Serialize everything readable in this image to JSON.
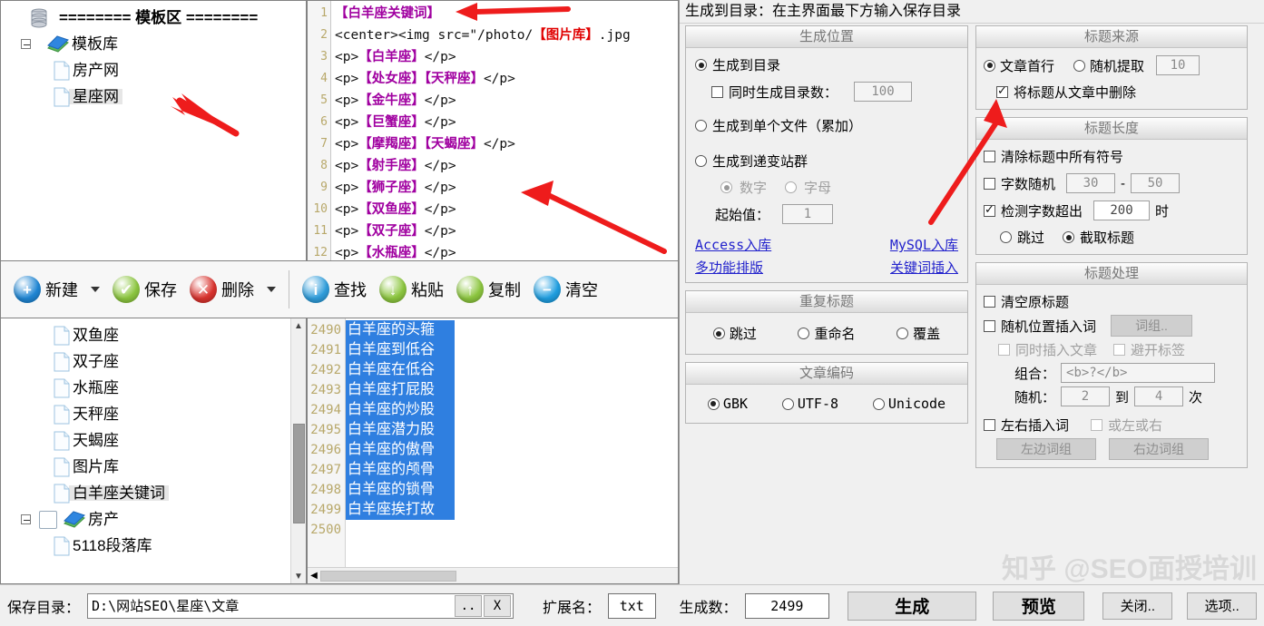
{
  "template_tree": {
    "root_label": "======== 模板区 ========",
    "root_icon": "database-icon",
    "items": [
      {
        "label": "模板库",
        "icon": "book-icon",
        "level": 1,
        "expander": true,
        "selected": false
      },
      {
        "label": "房产网",
        "icon": "doc-icon",
        "level": 2,
        "expander": false,
        "selected": false
      },
      {
        "label": "星座网",
        "icon": "doc-icon",
        "level": 2,
        "expander": false,
        "selected": true
      }
    ]
  },
  "editor": {
    "lines": [
      {
        "n": "1",
        "parts": [
          {
            "t": "【白羊座关键词】",
            "c": "kw"
          }
        ]
      },
      {
        "n": "2",
        "parts": [
          {
            "t": "<center><img src=\"/photo/",
            "c": "tag"
          },
          {
            "t": "【图片库】",
            "c": "kwred"
          },
          {
            "t": ".jpg",
            "c": "tag"
          }
        ]
      },
      {
        "n": "3",
        "parts": [
          {
            "t": "<p>",
            "c": "tag"
          },
          {
            "t": "【白羊座】",
            "c": "kw"
          },
          {
            "t": "</p>",
            "c": "tag"
          }
        ]
      },
      {
        "n": "4",
        "parts": [
          {
            "t": "<p>",
            "c": "tag"
          },
          {
            "t": "【处女座】",
            "c": "kw"
          },
          {
            "t": "【天秤座】",
            "c": "kw"
          },
          {
            "t": "</p>",
            "c": "tag"
          }
        ]
      },
      {
        "n": "5",
        "parts": [
          {
            "t": "<p>",
            "c": "tag"
          },
          {
            "t": "【金牛座】",
            "c": "kw"
          },
          {
            "t": "</p>",
            "c": "tag"
          }
        ]
      },
      {
        "n": "6",
        "parts": [
          {
            "t": "<p>",
            "c": "tag"
          },
          {
            "t": "【巨蟹座】",
            "c": "kw"
          },
          {
            "t": "</p>",
            "c": "tag"
          }
        ]
      },
      {
        "n": "7",
        "parts": [
          {
            "t": "<p>",
            "c": "tag"
          },
          {
            "t": "【摩羯座】",
            "c": "kw"
          },
          {
            "t": "【天蝎座】",
            "c": "kw"
          },
          {
            "t": "</p>",
            "c": "tag"
          }
        ]
      },
      {
        "n": "8",
        "parts": [
          {
            "t": "<p>",
            "c": "tag"
          },
          {
            "t": "【射手座】",
            "c": "kw"
          },
          {
            "t": "</p>",
            "c": "tag"
          }
        ]
      },
      {
        "n": "9",
        "parts": [
          {
            "t": "<p>",
            "c": "tag"
          },
          {
            "t": "【狮子座】",
            "c": "kw"
          },
          {
            "t": "</p>",
            "c": "tag"
          }
        ]
      },
      {
        "n": "10",
        "parts": [
          {
            "t": "<p>",
            "c": "tag"
          },
          {
            "t": "【双鱼座】",
            "c": "kw"
          },
          {
            "t": "</p>",
            "c": "tag"
          }
        ]
      },
      {
        "n": "11",
        "parts": [
          {
            "t": "<p>",
            "c": "tag"
          },
          {
            "t": "【双子座】",
            "c": "kw"
          },
          {
            "t": "</p>",
            "c": "tag"
          }
        ]
      },
      {
        "n": "12",
        "parts": [
          {
            "t": "<p>",
            "c": "tag"
          },
          {
            "t": "【水瓶座】",
            "c": "kw"
          },
          {
            "t": "</p>",
            "c": "tag"
          }
        ]
      }
    ]
  },
  "toolbar": {
    "buttons": [
      {
        "label": "新建",
        "icon": "plus-circle-icon",
        "color": "#1f86d4",
        "dropdown": true
      },
      {
        "label": "保存",
        "icon": "check-circle-icon",
        "color": "#8cc63f",
        "dropdown": false
      },
      {
        "label": "删除",
        "icon": "x-circle-icon",
        "color": "#d9332e",
        "dropdown": true
      },
      {
        "label": "查找",
        "icon": "info-circle-icon",
        "color": "#2f9ddb",
        "dropdown": false,
        "sep_before": true
      },
      {
        "label": "粘贴",
        "icon": "arrow-down-circle-icon",
        "color": "#8cc63f",
        "dropdown": false
      },
      {
        "label": "复制",
        "icon": "arrow-up-circle-icon",
        "color": "#8cc63f",
        "dropdown": false
      },
      {
        "label": "清空",
        "icon": "minus-circle-icon",
        "color": "#1f9ee0",
        "dropdown": false
      }
    ]
  },
  "library_tree": {
    "items": [
      {
        "label": "双鱼座",
        "icon": "doc-icon",
        "level": 2,
        "expander": false,
        "checkbox": false,
        "selected": false
      },
      {
        "label": "双子座",
        "icon": "doc-icon",
        "level": 2,
        "expander": false,
        "checkbox": false,
        "selected": false
      },
      {
        "label": "水瓶座",
        "icon": "doc-icon",
        "level": 2,
        "expander": false,
        "checkbox": false,
        "selected": false
      },
      {
        "label": "天秤座",
        "icon": "doc-icon",
        "level": 2,
        "expander": false,
        "checkbox": false,
        "selected": false
      },
      {
        "label": "天蝎座",
        "icon": "doc-icon",
        "level": 2,
        "expander": false,
        "checkbox": false,
        "selected": false
      },
      {
        "label": "图片库",
        "icon": "doc-icon",
        "level": 2,
        "expander": false,
        "checkbox": false,
        "selected": false
      },
      {
        "label": "白羊座关键词",
        "icon": "doc-icon",
        "level": 2,
        "expander": false,
        "checkbox": false,
        "selected": true
      },
      {
        "label": "房产",
        "icon": "book-icon",
        "level": 1,
        "expander": true,
        "checkbox": true,
        "selected": false
      },
      {
        "label": "5118段落库",
        "icon": "doc-icon",
        "level": 2,
        "expander": false,
        "checkbox": false,
        "selected": false
      }
    ]
  },
  "keyword_list": {
    "rows": [
      {
        "n": "2490",
        "text": "白羊座的头箍",
        "selected": true
      },
      {
        "n": "2491",
        "text": "白羊座到低谷",
        "selected": true
      },
      {
        "n": "2492",
        "text": "白羊座在低谷",
        "selected": true
      },
      {
        "n": "2493",
        "text": "白羊座打屁股",
        "selected": true
      },
      {
        "n": "2494",
        "text": "白羊座的炒股",
        "selected": true
      },
      {
        "n": "2495",
        "text": "白羊座潜力股",
        "selected": true
      },
      {
        "n": "2496",
        "text": "白羊座的傲骨",
        "selected": true
      },
      {
        "n": "2497",
        "text": "白羊座的颅骨",
        "selected": true
      },
      {
        "n": "2498",
        "text": "白羊座的锁骨",
        "selected": true
      },
      {
        "n": "2499",
        "text": "白羊座挨打故",
        "selected": true
      },
      {
        "n": "2500",
        "text": "",
        "selected": false
      }
    ]
  },
  "right_panel": {
    "header": "生成到目录：在主界面最下方输入保存目录",
    "generate_location": {
      "title": "生成位置",
      "opt_dir": "生成到目录",
      "opt_dir_checked": true,
      "chk_dircount": "同时生成目录数：",
      "chk_dircount_checked": false,
      "dircount_value": "100",
      "opt_single": "生成到单个文件（累加）",
      "opt_single_checked": false,
      "opt_progressive": "生成到递变站群",
      "opt_progressive_checked": false,
      "opt_number": "数字",
      "opt_number_checked": true,
      "opt_letter": "字母",
      "opt_letter_checked": false,
      "start_label": "起始值：",
      "start_value": "1",
      "links": [
        "Access入库",
        "MySQL入库",
        "多功能排版",
        "关键词插入"
      ]
    },
    "duplicate_title": {
      "title": "重复标题",
      "options": [
        "跳过",
        "重命名",
        "覆盖"
      ],
      "selected": "跳过"
    },
    "article_encoding": {
      "title": "文章编码",
      "options": [
        "GBK",
        "UTF-8",
        "Unicode"
      ],
      "selected": "GBK"
    },
    "title_source": {
      "title": "标题来源",
      "opt_first_line": "文章首行",
      "opt_first_line_checked": true,
      "opt_random": "随机提取",
      "opt_random_checked": false,
      "random_value": "10",
      "chk_remove": "将标题从文章中删除",
      "chk_remove_checked": true
    },
    "title_length": {
      "title": "标题长度",
      "chk_clear_symbols": "清除标题中所有符号",
      "chk_clear_symbols_checked": false,
      "chk_random_count": "字数随机",
      "chk_random_count_checked": false,
      "random_min": "30",
      "random_dash": "-",
      "random_max": "50",
      "chk_detect": "检测字数超出",
      "chk_detect_checked": true,
      "detect_value": "200",
      "detect_suffix": "时",
      "opt_skip": "跳过",
      "opt_skip_checked": false,
      "opt_truncate": "截取标题",
      "opt_truncate_checked": true
    },
    "title_processing": {
      "title": "标题处理",
      "chk_clear_original": "清空原标题",
      "chk_clear_original_checked": false,
      "chk_random_insert": "随机位置插入词",
      "chk_random_insert_checked": false,
      "btn_wordgroup": "词组..",
      "chk_insert_article": "同时插入文章",
      "chk_insert_article_checked": false,
      "chk_avoid_tags": "避开标签",
      "chk_avoid_tags_checked": false,
      "combo_label": "组合：",
      "combo_value": "<b>?</b>",
      "random_label": "随机：",
      "random_from": "2",
      "random_to_label": "到",
      "random_to": "4",
      "random_times": "次",
      "chk_lr_insert": "左右插入词",
      "chk_lr_insert_checked": false,
      "chk_or_lr": "或左或右",
      "chk_or_lr_checked": false,
      "btn_left_group": "左边词组",
      "btn_right_group": "右边词组"
    }
  },
  "status_bar": {
    "save_dir_label": "保存目录：",
    "save_dir_value": "D:\\网站SEO\\星座\\文章",
    "browse_button": "..",
    "clear_button": "X",
    "ext_label": "扩展名：",
    "ext_value": "txt",
    "count_label": "生成数：",
    "count_value": "2499",
    "generate_button": "生成",
    "preview_button": "预览",
    "close_button": "关闭..",
    "options_button": "选项.."
  },
  "watermark": "知乎 @SEO面授培训"
}
